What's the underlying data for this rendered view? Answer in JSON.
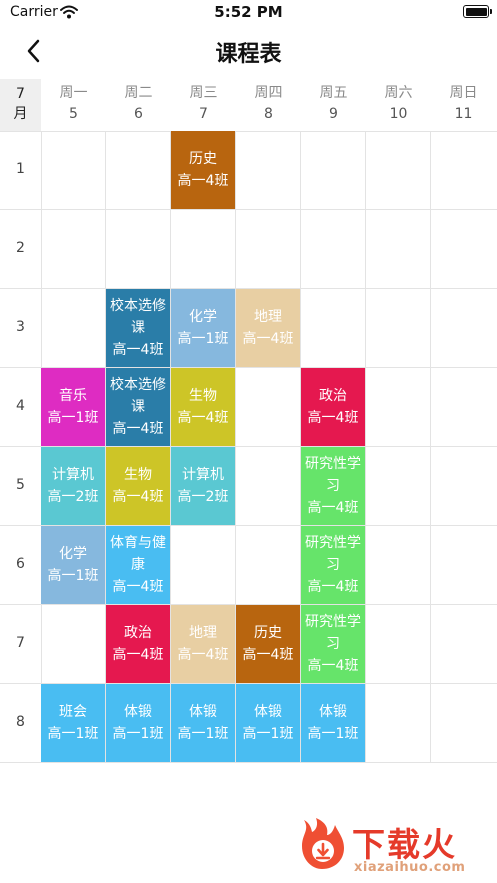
{
  "status_bar": {
    "carrier": "Carrier",
    "time": "5:52 PM"
  },
  "nav": {
    "title": "课程表"
  },
  "header": {
    "month_num": "7",
    "month_unit": "月",
    "days": [
      {
        "name": "周一",
        "date": "5"
      },
      {
        "name": "周二",
        "date": "6"
      },
      {
        "name": "周三",
        "date": "7"
      },
      {
        "name": "周四",
        "date": "8"
      },
      {
        "name": "周五",
        "date": "9"
      },
      {
        "name": "周六",
        "date": "10"
      },
      {
        "name": "周日",
        "date": "11"
      }
    ]
  },
  "periods": [
    "1",
    "2",
    "3",
    "4",
    "5",
    "6",
    "7",
    "8"
  ],
  "courses": [
    {
      "day": 3,
      "period": 1,
      "name": "历史",
      "class": "高一4班",
      "color": "#b8650f"
    },
    {
      "day": 2,
      "period": 3,
      "name": "校本选修课",
      "class": "高一4班",
      "color": "#2a7da8"
    },
    {
      "day": 3,
      "period": 3,
      "name": "化学",
      "class": "高一1班",
      "color": "#86b8de"
    },
    {
      "day": 4,
      "period": 3,
      "name": "地理",
      "class": "高一4班",
      "color": "#e8cfa3"
    },
    {
      "day": 1,
      "period": 4,
      "name": "音乐",
      "class": "高一1班",
      "color": "#de2cc2"
    },
    {
      "day": 2,
      "period": 4,
      "name": "校本选修课",
      "class": "高一4班",
      "color": "#2a7da8"
    },
    {
      "day": 3,
      "period": 4,
      "name": "生物",
      "class": "高一4班",
      "color": "#cdc527"
    },
    {
      "day": 5,
      "period": 4,
      "name": "政治",
      "class": "高一4班",
      "color": "#e5184f"
    },
    {
      "day": 1,
      "period": 5,
      "name": "计算机",
      "class": "高一2班",
      "color": "#5ac8d2"
    },
    {
      "day": 2,
      "period": 5,
      "name": "生物",
      "class": "高一4班",
      "color": "#cdc527"
    },
    {
      "day": 3,
      "period": 5,
      "name": "计算机",
      "class": "高一2班",
      "color": "#5ac8d2"
    },
    {
      "day": 5,
      "period": 5,
      "name": "研究性学习",
      "class": "高一4班",
      "color": "#66e46a"
    },
    {
      "day": 1,
      "period": 6,
      "name": "化学",
      "class": "高一1班",
      "color": "#86b8de"
    },
    {
      "day": 2,
      "period": 6,
      "name": "体育与健康",
      "class": "高一4班",
      "color": "#49bdf2"
    },
    {
      "day": 5,
      "period": 6,
      "name": "研究性学习",
      "class": "高一4班",
      "color": "#66e46a"
    },
    {
      "day": 2,
      "period": 7,
      "name": "政治",
      "class": "高一4班",
      "color": "#e5184f"
    },
    {
      "day": 3,
      "period": 7,
      "name": "地理",
      "class": "高一4班",
      "color": "#e8cfa3"
    },
    {
      "day": 4,
      "period": 7,
      "name": "历史",
      "class": "高一4班",
      "color": "#b8650f"
    },
    {
      "day": 5,
      "period": 7,
      "name": "研究性学习",
      "class": "高一4班",
      "color": "#66e46a"
    },
    {
      "day": 1,
      "period": 8,
      "name": "班会",
      "class": "高一1班",
      "color": "#49bdf2"
    },
    {
      "day": 2,
      "period": 8,
      "name": "体锻",
      "class": "高一1班",
      "color": "#49bdf2"
    },
    {
      "day": 3,
      "period": 8,
      "name": "体锻",
      "class": "高一1班",
      "color": "#49bdf2"
    },
    {
      "day": 4,
      "period": 8,
      "name": "体锻",
      "class": "高一1班",
      "color": "#49bdf2"
    },
    {
      "day": 5,
      "period": 8,
      "name": "体锻",
      "class": "高一1班",
      "color": "#49bdf2"
    }
  ],
  "watermark": {
    "brand_cn": "下载火",
    "brand_en": "xiazaihuo.com"
  }
}
